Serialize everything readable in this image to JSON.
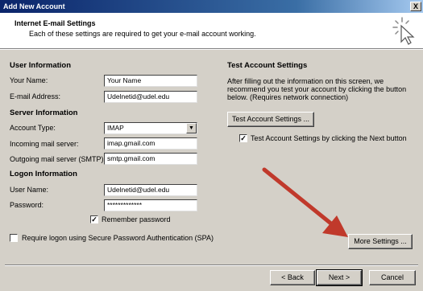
{
  "window": {
    "title": "Add New Account",
    "close_glyph": "X"
  },
  "header": {
    "title": "Internet E-mail Settings",
    "subtitle": "Each of these settings are required to get your e-mail account working.",
    "icon": "click-cursor-icon"
  },
  "user_info": {
    "heading": "User Information",
    "name_label": "Your Name:",
    "name_value": "Your Name",
    "email_label": "E-mail Address:",
    "email_value": "Udelnetid@udel.edu"
  },
  "server_info": {
    "heading": "Server Information",
    "account_type_label": "Account Type:",
    "account_type_value": "IMAP",
    "incoming_label": "Incoming mail server:",
    "incoming_value": "imap.gmail.com",
    "outgoing_label": "Outgoing mail server (SMTP):",
    "outgoing_value": "smtp.gmail.com"
  },
  "logon_info": {
    "heading": "Logon Information",
    "username_label": "User Name:",
    "username_value": "Udelnetid@udel.edu",
    "password_label": "Password:",
    "password_value": "*************",
    "remember_label": "Remember password",
    "spa_label": "Require logon using Secure Password Authentication (SPA)"
  },
  "test_settings": {
    "heading": "Test Account Settings",
    "description": [
      "After filling out the information on this screen, we",
      "recommend you test your account by clicking the button",
      "below. (Requires network connection)"
    ],
    "test_button": "Test Account Settings ...",
    "next_checkbox_label": "Test Account Settings by clicking the Next button"
  },
  "more_settings_button": "More Settings ...",
  "footer": {
    "back": "< Back",
    "next": "Next >",
    "cancel": "Cancel"
  },
  "colors": {
    "arrow": "#c0392b",
    "dialog_bg": "#d4d0c8",
    "title_bar": "#0a246a"
  }
}
